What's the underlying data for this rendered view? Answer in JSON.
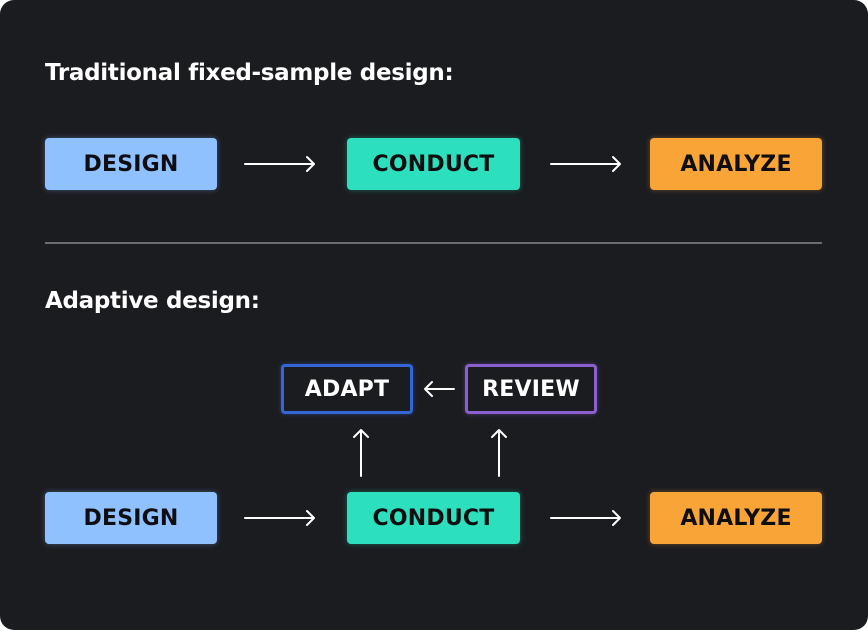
{
  "sections": {
    "traditional": {
      "title": "Traditional fixed-sample design:",
      "steps": [
        "DESIGN",
        "CONDUCT",
        "ANALYZE"
      ]
    },
    "adaptive": {
      "title": "Adaptive design:",
      "steps": [
        "DESIGN",
        "CONDUCT",
        "ANALYZE"
      ],
      "loop": [
        "ADAPT",
        "REVIEW"
      ]
    }
  },
  "colors": {
    "background": "#1b1c20",
    "design": "#8fc0ff",
    "conduct": "#2ce0bd",
    "analyze": "#f9a436",
    "adapt_border": "#3566d6",
    "review_border": "#8b5fd0",
    "divider": "#6d6d70"
  },
  "edges": [
    {
      "from": "DESIGN",
      "to": "CONDUCT",
      "section": "traditional"
    },
    {
      "from": "CONDUCT",
      "to": "ANALYZE",
      "section": "traditional"
    },
    {
      "from": "DESIGN",
      "to": "CONDUCT",
      "section": "adaptive"
    },
    {
      "from": "CONDUCT",
      "to": "ANALYZE",
      "section": "adaptive"
    },
    {
      "from": "CONDUCT",
      "to": "ADAPT",
      "section": "adaptive"
    },
    {
      "from": "CONDUCT",
      "to": "REVIEW",
      "section": "adaptive"
    },
    {
      "from": "REVIEW",
      "to": "ADAPT",
      "section": "adaptive"
    }
  ]
}
